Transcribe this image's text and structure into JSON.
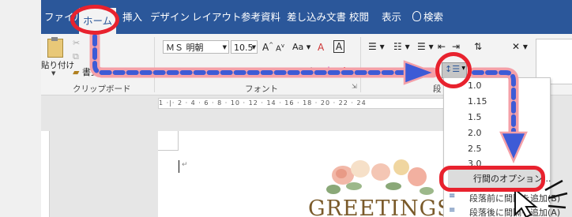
{
  "ribbon_tabs": {
    "file": "ファイル",
    "home": "ホーム",
    "insert": "挿入",
    "design": "デザイン",
    "layout": "レイアウト",
    "references": "参考資料",
    "mailings": "差し込み文書",
    "review": "校閲",
    "view": "表示",
    "search": "検索"
  },
  "clipboard": {
    "paste": "貼り付け",
    "format_painter": "書式",
    "group_label": "クリップボード"
  },
  "font": {
    "font_name": "ＭＳ 明朝",
    "font_size": "10.5",
    "grow": "A",
    "shrink": "A",
    "case": "Aa",
    "clear": "A",
    "border_char": "A",
    "group_label": "フォント"
  },
  "paragraph": {
    "group_label": "段"
  },
  "ruler_text": "1 ·|· 2 · 4 · 6 · 8 · 10 · 12 · 14 · 16 · 18 · 20 · 22 · 24",
  "line_spacing_menu": {
    "options": [
      "1.0",
      "1.15",
      "1.5",
      "2.0",
      "2.5",
      "3.0"
    ],
    "line_options": "行間のオプション...",
    "space_before": "段落前に間隔を追加(B)",
    "space_after": "段落後に間隔を追加(A)"
  },
  "document": {
    "greeting": "GREETINGS"
  },
  "colors": {
    "ribbon_blue": "#2b579a",
    "annotation_red": "#e8222e",
    "annotation_dash_blue": "#3d5bd6"
  }
}
